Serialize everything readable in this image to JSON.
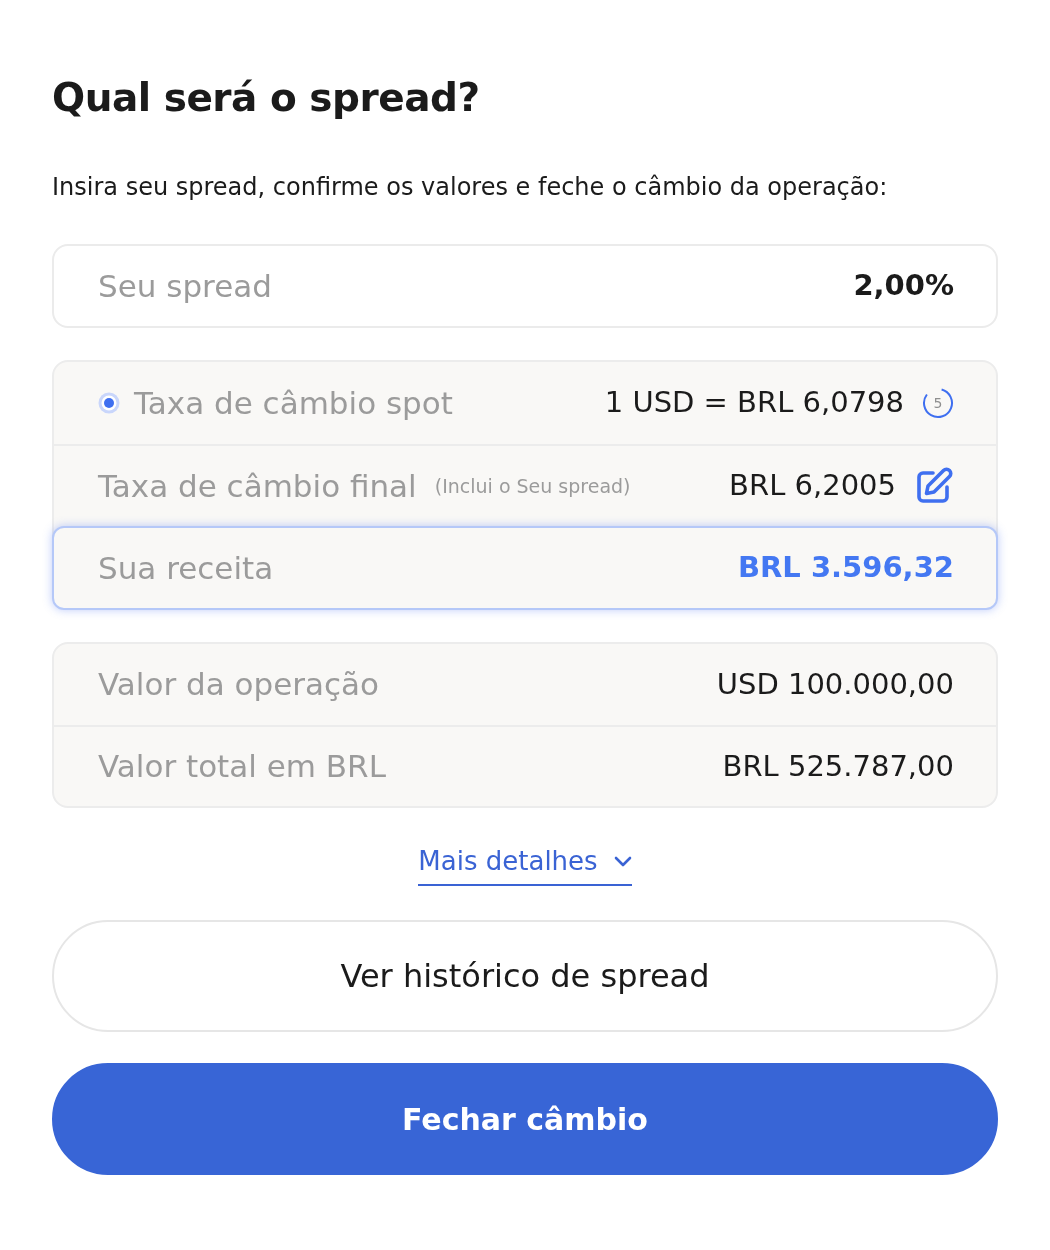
{
  "heading": "Qual será o spread?",
  "intro": "Insira seu spread, confirme os valores e feche o câmbio da operação:",
  "spread_field": {
    "label": "Seu spread",
    "value": "2,00%"
  },
  "rates": [
    {
      "kind": "spot",
      "label": "Taxa de câmbio spot",
      "value": "1 USD = BRL 6,0798",
      "live": true,
      "countdown": "5",
      "highlighted": false
    },
    {
      "kind": "final",
      "label": "Taxa de câmbio final",
      "note": "(Inclui o Seu spread)",
      "value": "BRL 6,2005",
      "editable": true,
      "highlighted": false
    },
    {
      "kind": "revenue",
      "label": "Sua receita",
      "value": "BRL 3.596,32",
      "highlighted": true
    }
  ],
  "totals": [
    {
      "label": "Valor da operação",
      "value": "USD 100.000,00"
    },
    {
      "label": "Valor total em BRL",
      "value": "BRL 525.787,00"
    }
  ],
  "details_link": {
    "label": "Mais detalhes",
    "expanded": false
  },
  "buttons": [
    {
      "kind": "secondary",
      "label": "Ver histórico de spread"
    },
    {
      "kind": "primary",
      "label": "Fechar câmbio"
    }
  ]
}
